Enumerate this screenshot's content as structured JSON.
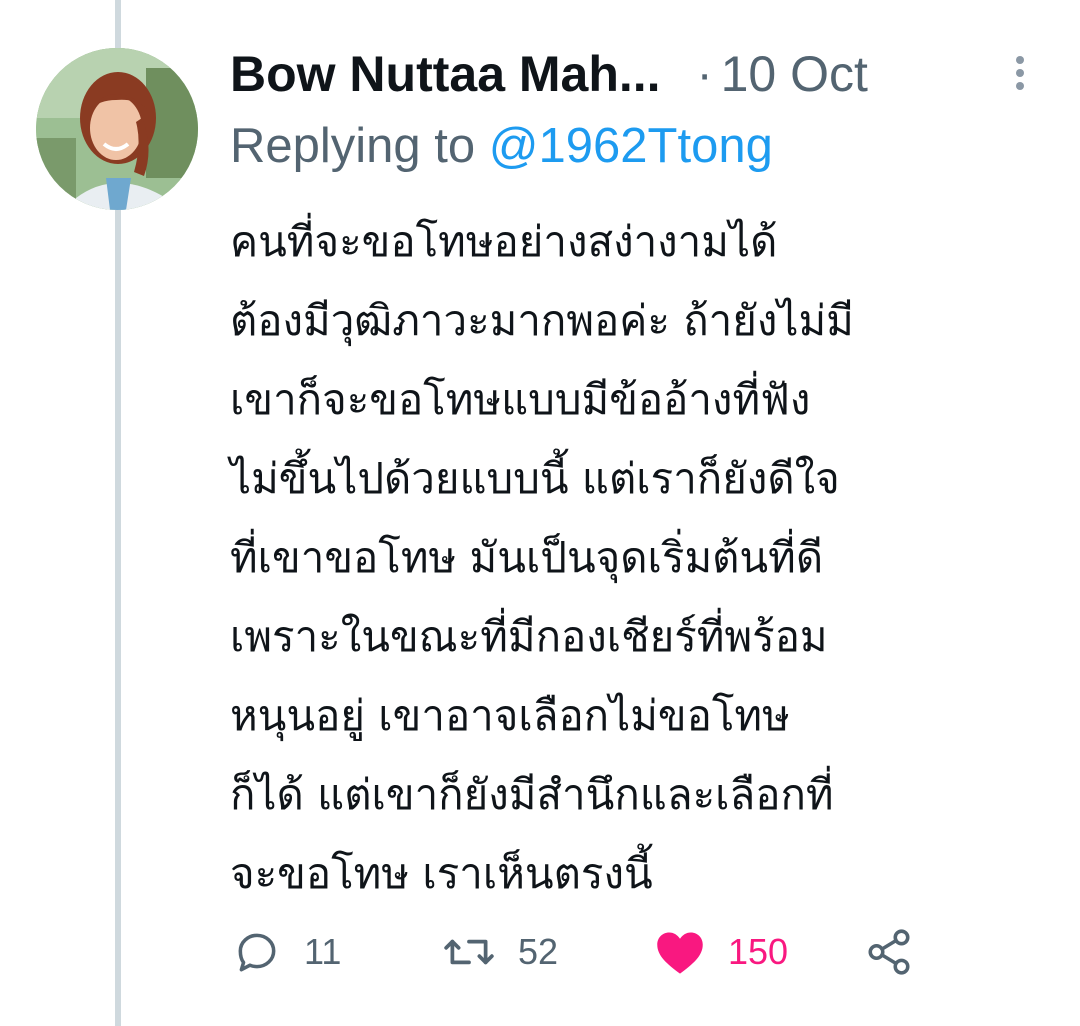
{
  "tweet": {
    "author": "Bow Nuttaa Mah...",
    "separator": "·",
    "time": "10 Oct",
    "reply_prefix": "Replying to",
    "reply_handle": "@1962Ttong",
    "text_lines": [
      "คนที่จะขอโทษอย่างสง่างามได้",
      "ต้องมีวุฒิภาวะมากพอค่ะ ถ้ายังไม่มี",
      "เขาก็จะขอโทษแบบมีข้ออ้างที่ฟัง",
      "ไม่ขึ้นไปด้วยแบบนี้ แต่เราก็ยังดีใจ",
      "ที่เขาขอโทษ มันเป็นจุดเริ่มต้นที่ดี",
      "เพราะในขณะที่มีกองเชียร์ที่พร้อม",
      "หนุนอยู่ เขาอาจเลือกไม่ขอโทษ",
      "ก็ได้ แต่เขาก็ยังมีสำนึกและเลือกที่",
      "จะขอโทษ เราเห็นตรงนี้"
    ]
  },
  "actions": {
    "reply_count": "11",
    "retweet_count": "52",
    "like_count": "150",
    "liked": true
  },
  "icons": {
    "reply": "reply-icon",
    "retweet": "retweet-icon",
    "like": "heart-icon",
    "share": "share-icon",
    "more": "more-options-icon"
  },
  "colors": {
    "text": "#0f1419",
    "secondary": "#536471",
    "link": "#1d9bf0",
    "like": "#f91880",
    "thread_line": "#cfd9de"
  }
}
